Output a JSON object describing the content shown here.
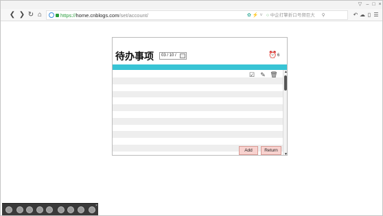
{
  "browser": {
    "controls": [
      "▽",
      "–",
      "□",
      "×"
    ],
    "url_scheme": "https://",
    "url_host": "home.cnblogs.com",
    "url_path": "/set/account/",
    "search_placeholder": "中企打擎折口号频巨大"
  },
  "app": {
    "title": "待办事项",
    "date_value": "03 / 10 /",
    "alarm_count": "6",
    "add_label": "Add",
    "return_label": "Return",
    "row_count": 17
  },
  "colors": {
    "band": "#38c4d5",
    "button": "#f8d2cf"
  }
}
